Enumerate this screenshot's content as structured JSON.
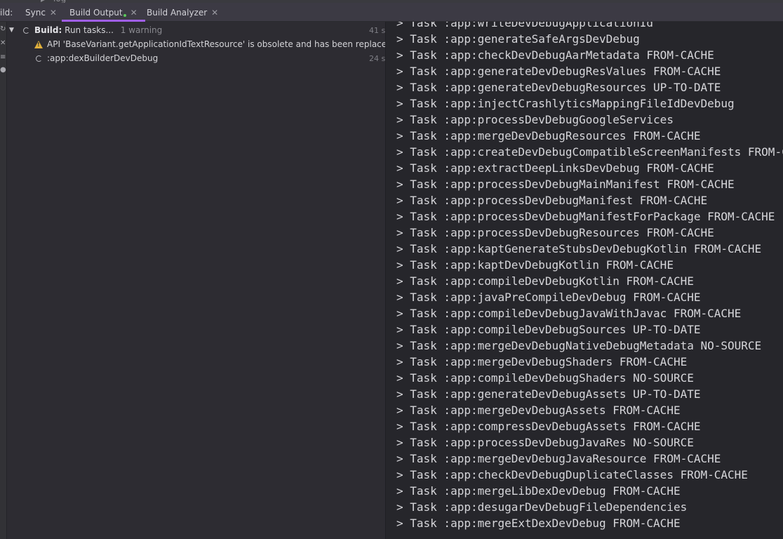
{
  "top_strip": {
    "crumb": "log"
  },
  "tabbar": {
    "prefix": "ild:",
    "tabs": [
      {
        "label": "Sync"
      },
      {
        "label": "Build Output"
      },
      {
        "label": "Build Analyzer"
      }
    ],
    "active_tab": "Build Output",
    "accent_color": "#a05fe6",
    "running_dot_color": "#5cc85c"
  },
  "tree": {
    "root": {
      "title": "Build:",
      "status": "Run tasks...",
      "summary": "1 warning",
      "time": "41 s",
      "expanded": true
    },
    "children": [
      {
        "icon": "warning-icon",
        "text": "API 'BaseVariant.getApplicationIdTextResource' is obsolete and has been replaced with 'Varia"
      },
      {
        "icon": "spinner-icon",
        "text": ":app:dexBuilderDevDebug",
        "time": "24 s"
      }
    ]
  },
  "console": {
    "lines": [
      "> Task :app:writeDevDebugApplicationId",
      "> Task :app:generateSafeArgsDevDebug",
      "> Task :app:checkDevDebugAarMetadata FROM-CACHE",
      "> Task :app:generateDevDebugResValues FROM-CACHE",
      "> Task :app:generateDevDebugResources UP-TO-DATE",
      "> Task :app:injectCrashlyticsMappingFileIdDevDebug",
      "> Task :app:processDevDebugGoogleServices",
      "> Task :app:mergeDevDebugResources FROM-CACHE",
      "> Task :app:createDevDebugCompatibleScreenManifests FROM-CACHE",
      "> Task :app:extractDeepLinksDevDebug FROM-CACHE",
      "> Task :app:processDevDebugMainManifest FROM-CACHE",
      "> Task :app:processDevDebugManifest FROM-CACHE",
      "> Task :app:processDevDebugManifestForPackage FROM-CACHE",
      "> Task :app:processDevDebugResources FROM-CACHE",
      "> Task :app:kaptGenerateStubsDevDebugKotlin FROM-CACHE",
      "> Task :app:kaptDevDebugKotlin FROM-CACHE",
      "> Task :app:compileDevDebugKotlin FROM-CACHE",
      "> Task :app:javaPreCompileDevDebug FROM-CACHE",
      "> Task :app:compileDevDebugJavaWithJavac FROM-CACHE",
      "> Task :app:compileDevDebugSources UP-TO-DATE",
      "> Task :app:mergeDevDebugNativeDebugMetadata NO-SOURCE",
      "> Task :app:mergeDevDebugShaders FROM-CACHE",
      "> Task :app:compileDevDebugShaders NO-SOURCE",
      "> Task :app:generateDevDebugAssets UP-TO-DATE",
      "> Task :app:mergeDevDebugAssets FROM-CACHE",
      "> Task :app:compressDevDebugAssets FROM-CACHE",
      "> Task :app:processDevDebugJavaRes NO-SOURCE",
      "> Task :app:mergeDevDebugJavaResource FROM-CACHE",
      "> Task :app:checkDevDebugDuplicateClasses FROM-CACHE",
      "> Task :app:mergeLibDexDevDebug FROM-CACHE",
      "> Task :app:desugarDevDebugFileDependencies",
      "> Task :app:mergeExtDexDevDebug FROM-CACHE"
    ]
  }
}
